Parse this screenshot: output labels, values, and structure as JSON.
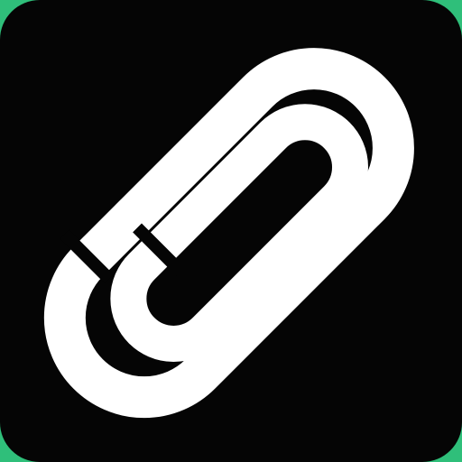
{
  "icon": {
    "name": "link-icon",
    "background_color": "#050505",
    "glyph_color": "#ffffff",
    "accent_color": "#2fbf7a"
  }
}
